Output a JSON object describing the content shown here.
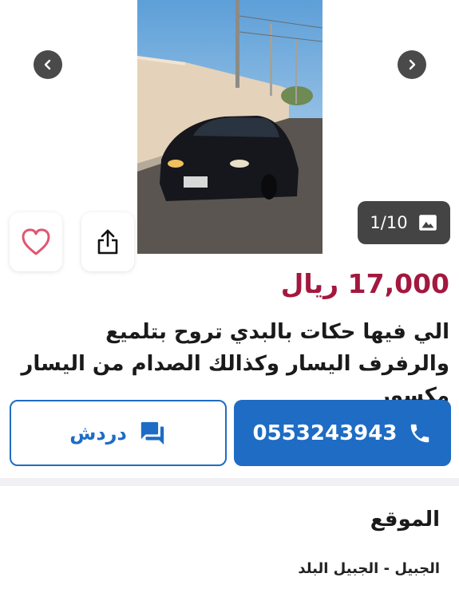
{
  "gallery": {
    "counter": "1/10"
  },
  "listing": {
    "price": "17,000 ريال",
    "title": "الي فيها حكات بالبدي تروح بتلميع والرفرف اليسار وكذالك الصدام من اليسار مكسور"
  },
  "actions": {
    "phone": "0553243943",
    "chat_label": "دردش"
  },
  "location": {
    "heading": "الموقع",
    "value": "الجبيل - الجبيل البلد"
  },
  "colors": {
    "price": "#a3183e",
    "accent": "#1e6cc4"
  }
}
